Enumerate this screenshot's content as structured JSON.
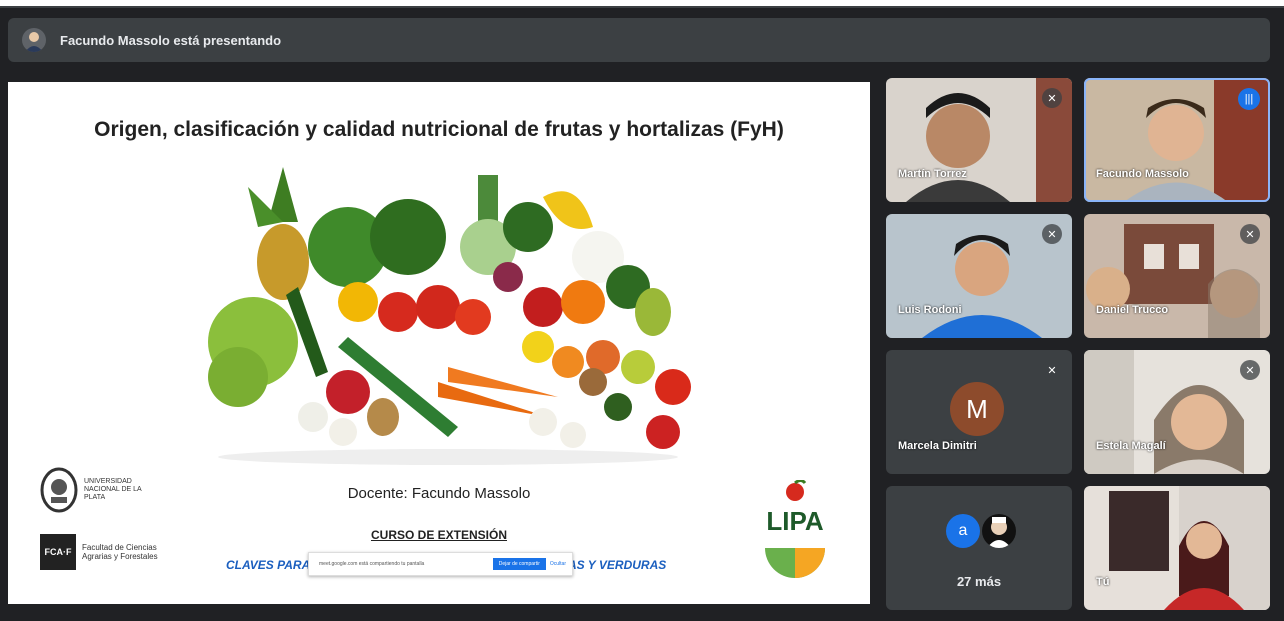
{
  "banner": {
    "presenting_text": "Facundo Massolo está presentando",
    "avatar_icon": "user-avatar-icon"
  },
  "slide": {
    "title": "Origen, clasificación y calidad nutricional de frutas y hortalizas (FyH)",
    "teacher": "Docente: Facundo Massolo",
    "course": "CURSO DE EXTENSIÓN",
    "subtitle_left": "CLAVES PARA",
    "subtitle_right": "AS Y VERDURAS",
    "unlp_logo_text": "UNIVERSIDAD NACIONAL DE LA PLATA",
    "fcaf_box": "FCA·F",
    "fcaf_text": "Facultad de Ciencias Agrarias y Forestales",
    "lipa_logo": "LIPA",
    "share_bar": {
      "message": "meet.google.com está compartiendo tu pantalla",
      "stop_label": "Dejar de compartir",
      "hide_label": "Ocultar"
    }
  },
  "participants": [
    {
      "name": "Martín Torrez",
      "muted": true
    },
    {
      "name": "Facundo Massolo",
      "speaking": true
    },
    {
      "name": "Luis Rodoni",
      "muted": true
    },
    {
      "name": "Daniel Trucco",
      "muted": true
    },
    {
      "name": "Marcela Dimitri",
      "initial": "M",
      "muted": true
    },
    {
      "name": "Estela Magalí",
      "muted": true
    },
    {
      "name": "Tú"
    }
  ],
  "more_tile": {
    "avatar_letter": "a",
    "count_label": "27 más"
  },
  "colors": {
    "background": "#202124",
    "tile": "#3c4043",
    "accent": "#1a73e8",
    "highlight": "#8ab4f8"
  }
}
